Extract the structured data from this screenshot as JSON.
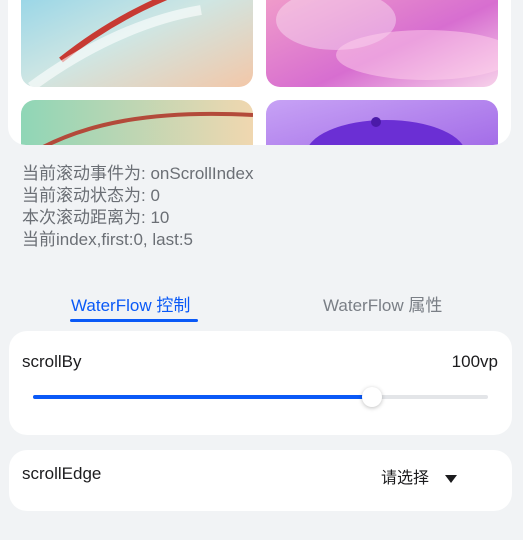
{
  "info": {
    "event_line": "当前滚动事件为: onScrollIndex",
    "state_line": "当前滚动状态为: 0",
    "distance_line": "本次滚动距离为: 10",
    "index_line": "当前index,first:0, last:5"
  },
  "tabs": [
    {
      "label": "WaterFlow 控制",
      "active": true
    },
    {
      "label": "WaterFlow 属性",
      "active": false
    }
  ],
  "scroll_by": {
    "label": "scrollBy",
    "value_text": "100vp",
    "slider_fraction": 0.745
  },
  "scroll_edge": {
    "label": "scrollEdge",
    "select_value": "请选择"
  },
  "colors": {
    "accent": "#0a59f7",
    "background": "#f1f3f5",
    "card": "#ffffff"
  },
  "icons": [
    "chevron-down-icon"
  ]
}
